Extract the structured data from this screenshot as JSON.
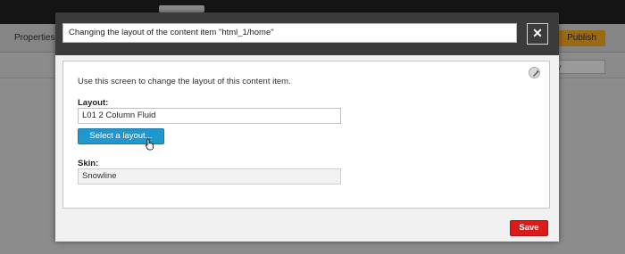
{
  "app": {
    "toolbar_properties": "Properties",
    "publish_label": "Publish",
    "filter_value": "y"
  },
  "modal": {
    "title": "Changing the layout of the content item \"html_1/home\"",
    "close_icon": "close-icon",
    "intro": "Use this screen to change the layout of this content item.",
    "help_icon": "help-icon",
    "layout": {
      "label": "Layout:",
      "value": "L01 2 Column Fluid",
      "select_button": "Select a layout..."
    },
    "skin": {
      "label": "Skin:",
      "value": "Snowline"
    },
    "save_label": "Save"
  },
  "colors": {
    "overlay": "#8f8f8f",
    "modal_frame": "#3b3b3b",
    "select_button": "#2197cf",
    "save_button": "#dd1a1a",
    "publish_button": "#9a6a12"
  }
}
